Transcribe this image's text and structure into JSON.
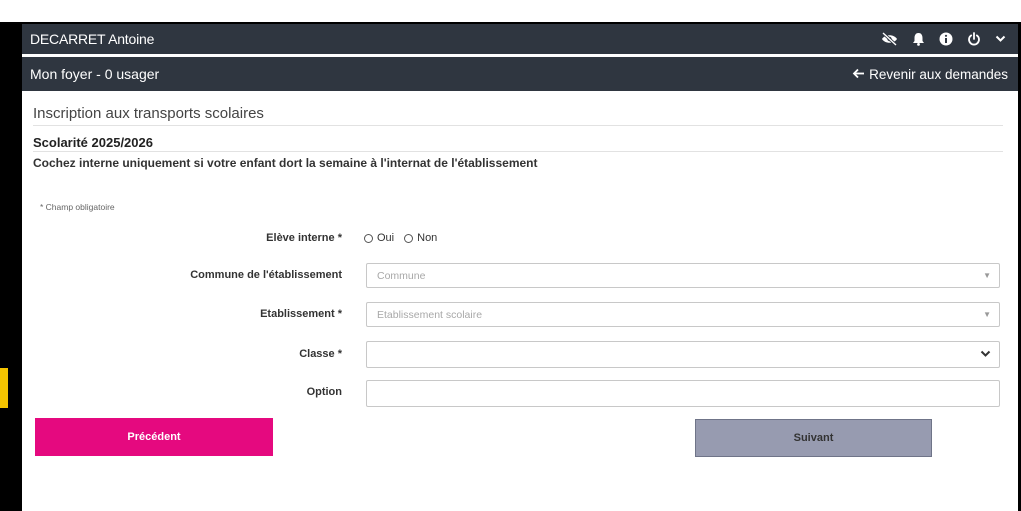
{
  "user": {
    "name": "DECARRET Antoine"
  },
  "household": {
    "title": "Mon foyer - 0 usager",
    "back_label": "Revenir aux demandes"
  },
  "page": {
    "title": "Inscription aux transports scolaires",
    "school_year": "Scolarité 2025/2026",
    "notice": "Cochez interne uniquement si votre enfant dort la semaine à l'internat de l'établissement",
    "mandatory_note": "* Champ obligatoire"
  },
  "form": {
    "interne": {
      "label": "Elève interne *",
      "options": [
        "Oui",
        "Non"
      ],
      "selected": ""
    },
    "commune": {
      "label": "Commune de l'établissement",
      "placeholder": "Commune"
    },
    "etablissement": {
      "label": "Etablissement *",
      "placeholder": "Etablissement scolaire"
    },
    "classe": {
      "label": "Classe *",
      "value": ""
    },
    "option": {
      "label": "Option",
      "value": ""
    }
  },
  "buttons": {
    "previous": "Précédent",
    "next": "Suivant"
  },
  "colors": {
    "header_bg": "#2f3640",
    "previous_bg": "#e5097f",
    "next_bg": "#979bb0"
  },
  "icons": [
    "eye-slash-icon",
    "bell-icon",
    "info-icon",
    "power-icon",
    "chevron-down-icon",
    "arrow-left-icon"
  ]
}
